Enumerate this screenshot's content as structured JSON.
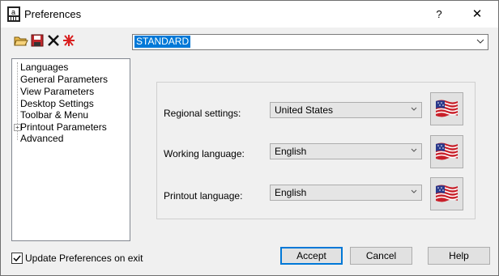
{
  "window": {
    "title": "Preferences",
    "help_label": "?",
    "close_label": "✕"
  },
  "toolbar": {
    "open_icon": "folder-open-icon",
    "save_icon": "save-icon",
    "delete_icon": "delete-x-icon",
    "reset_icon": "reset-spark-icon"
  },
  "profile": {
    "value": "STANDARD"
  },
  "tree": {
    "items": [
      {
        "label": "Languages"
      },
      {
        "label": "General Parameters"
      },
      {
        "label": "View Parameters"
      },
      {
        "label": "Desktop Settings"
      },
      {
        "label": "Toolbar & Menu"
      },
      {
        "label": "Printout Parameters",
        "expander": "+"
      },
      {
        "label": "Advanced"
      }
    ]
  },
  "languages": {
    "regional": {
      "label": "Regional settings:",
      "value": "United States",
      "flag": "us-flag-icon"
    },
    "working": {
      "label": "Working language:",
      "value": "English",
      "flag": "us-flag-icon"
    },
    "printout": {
      "label": "Printout language:",
      "value": "English",
      "flag": "us-flag-icon"
    }
  },
  "footer": {
    "update_checkbox_label": "Update Preferences on exit",
    "update_checked": true,
    "accept_label": "Accept",
    "cancel_label": "Cancel",
    "help_label": "Help"
  }
}
